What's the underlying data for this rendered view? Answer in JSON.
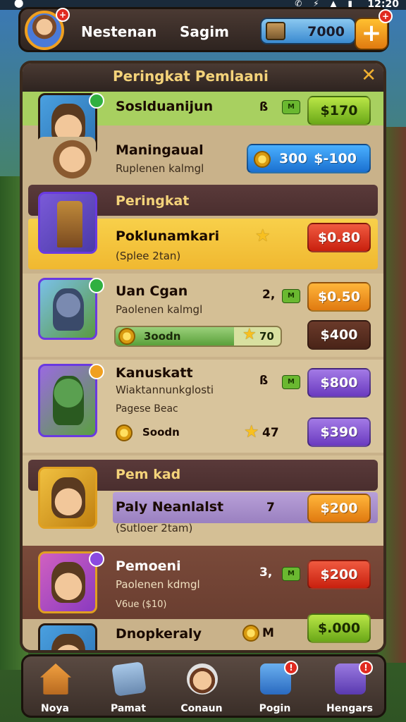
{
  "status": {
    "time": "12:20",
    "icons": "✆ ⚡ ▲ ▮"
  },
  "header": {
    "player_name": "Nestenan",
    "player_name2": "Sagim",
    "coins": "7000",
    "plus": "+"
  },
  "panel": {
    "title": "Peringkat Pemlaani",
    "close": "✕"
  },
  "rows": [
    {
      "title": "Soslduanijun",
      "sub": "",
      "stat": "ß",
      "tag": "M",
      "price": "$170",
      "color": "green"
    },
    {
      "title": "Maningaual",
      "sub": "Ruplenen kalmgl",
      "coin_label": "300",
      "price": "$-100",
      "color": "blue"
    },
    {
      "section": "Peringkat"
    },
    {
      "title": "Poklunamkari",
      "sub": "(Splee 2tan)",
      "price": "$0.80",
      "color": "red"
    },
    {
      "title": "Uan Cgan",
      "sub": "Paolenen kalmgl",
      "stat": "2,",
      "tag": "M",
      "price": "$0.50",
      "color": "orange",
      "progress_label": "3oodn",
      "progress_val": "70",
      "progress_pct": 0.72,
      "price2": "$400",
      "color2": "brown"
    },
    {
      "title": "Kanuskatt",
      "sub": "Wiaktannunkglosti",
      "sub2": "Pagese Beac",
      "stat": "ß",
      "tag": "M",
      "price": "$800",
      "color": "purple",
      "progress_label": "Soodn",
      "progress_val": "47",
      "price2": "$390",
      "color2": "purple"
    },
    {
      "section": "Pem kad"
    },
    {
      "title": "Paly Neanlalst",
      "sub": "(Sutloer 2tam)",
      "stat": "7",
      "price": "$200",
      "color": "orange"
    },
    {
      "title": "Pemoeni",
      "sub": "Paolenen kdmgl",
      "sub2": "V6ue ($10)",
      "stat": "3,",
      "tag": "M",
      "price": "$200",
      "color": "red"
    },
    {
      "title": "Dnopkeraly",
      "stat": "M",
      "price": "$.000",
      "color": "green"
    }
  ],
  "nav": [
    {
      "label": "Noya",
      "icon": "home-icon"
    },
    {
      "label": "Pamat",
      "icon": "cards-icon"
    },
    {
      "label": "Conaun",
      "icon": "profile-icon"
    },
    {
      "label": "Pogin",
      "icon": "shop-icon"
    },
    {
      "label": "Hengars",
      "icon": "settings-icon"
    }
  ],
  "colors": {
    "accent": "#f4d37a",
    "panel": "#c9b28a",
    "frame": "#3a2a1e"
  }
}
